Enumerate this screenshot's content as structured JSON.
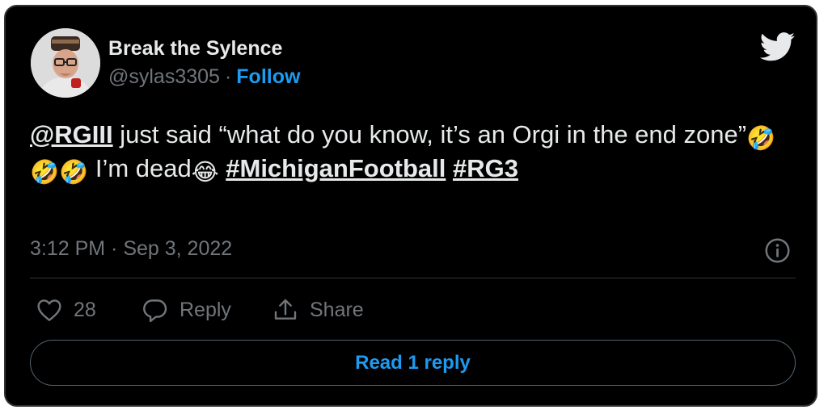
{
  "author": {
    "name": "Break the Sylence",
    "handle": "@sylas3305",
    "separator": "·",
    "follow_label": "Follow"
  },
  "icons": {
    "brand": "twitter-bird-icon",
    "info": "info-icon",
    "like": "heart-icon",
    "reply": "speech-bubble-icon",
    "share": "share-arrow-icon"
  },
  "tweet": {
    "mention": "@RGIII",
    "text_part1": " just said “what do you know, it’s an Orgi in the end zone”",
    "emoji_rofl": "🤣",
    "text_part2": " I’m dead",
    "emoji_tears": "😂",
    "hashtag1": "#MichiganFootball",
    "hashtag2": "#RG3"
  },
  "meta": {
    "timestamp": "3:12 PM · Sep 3, 2022"
  },
  "actions": {
    "like_count": "28",
    "reply_label": "Reply",
    "share_label": "Share"
  },
  "footer": {
    "read_replies_label": "Read 1 reply"
  },
  "colors": {
    "background": "#000000",
    "text": "#e7e9ea",
    "muted": "#71767b",
    "accent": "#1d9bf0",
    "border": "#2f3336"
  }
}
